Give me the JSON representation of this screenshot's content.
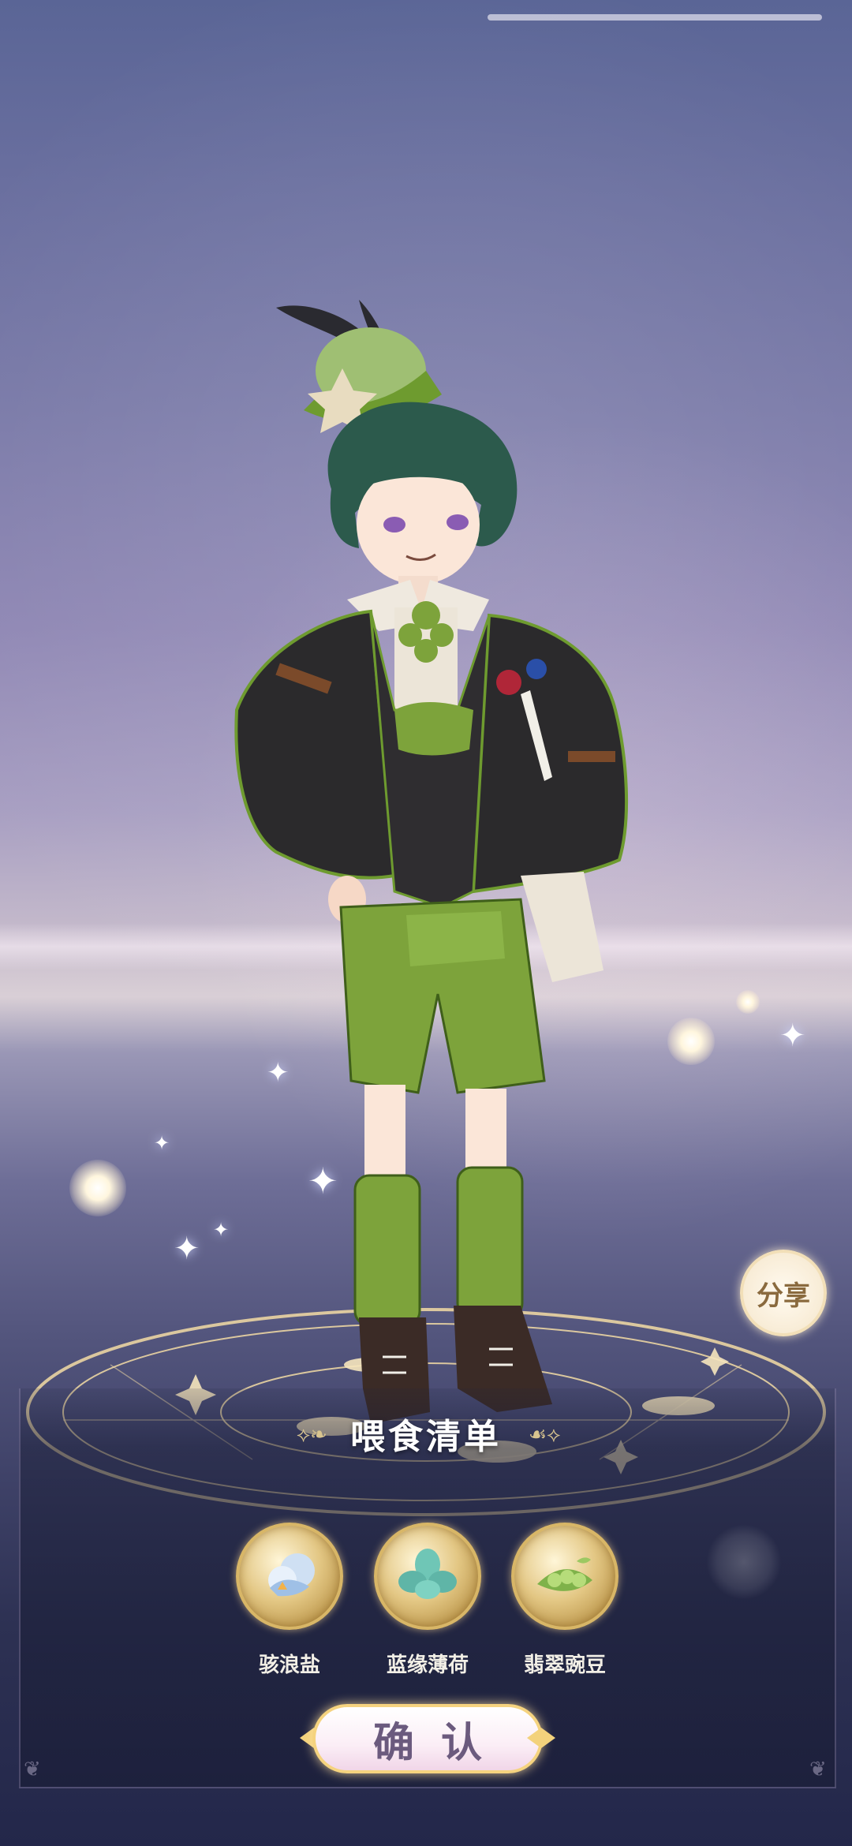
{
  "share": {
    "label": "分享"
  },
  "feed_list": {
    "title": "喂食清单",
    "items": [
      {
        "name": "骇浪盐",
        "icon": "salt-icon"
      },
      {
        "name": "蓝缘薄荷",
        "icon": "mint-icon"
      },
      {
        "name": "翡翠豌豆",
        "icon": "pea-icon"
      }
    ]
  },
  "confirm": {
    "label": "确认"
  },
  "colors": {
    "accent_gold": "#d8b667",
    "character_green": "#7da33b",
    "jacket": "#2b2a2c"
  }
}
